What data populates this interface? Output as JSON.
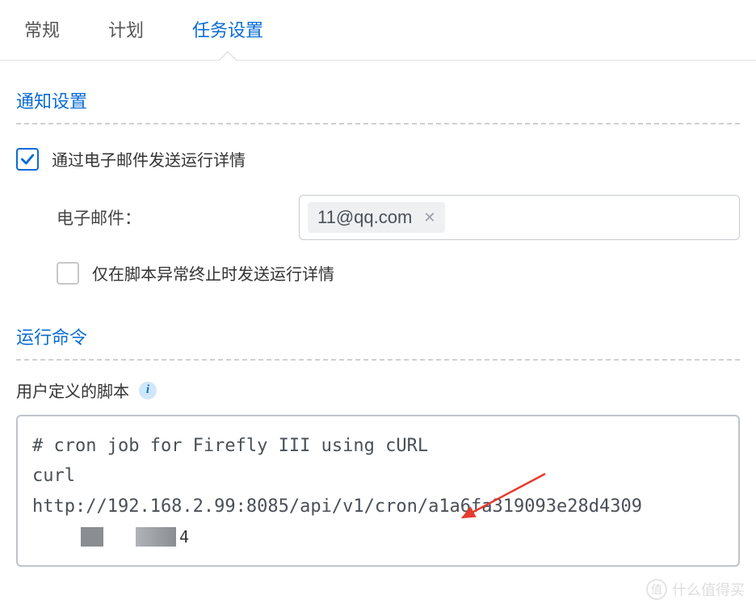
{
  "tabs": [
    {
      "label": "常规",
      "active": false
    },
    {
      "label": "计划",
      "active": false
    },
    {
      "label": "任务设置",
      "active": true
    }
  ],
  "sections": {
    "notification": {
      "title": "通知设置",
      "emailDetailsCheckbox": {
        "checked": true,
        "label": "通过电子邮件发送运行详情"
      },
      "emailField": {
        "label": "电子邮件：",
        "tag": "11@qq.com"
      },
      "onlyOnErrorCheckbox": {
        "checked": false,
        "label": "仅在脚本异常终止时发送运行详情"
      }
    },
    "runCommand": {
      "title": "运行命令",
      "userScriptLabel": "用户定义的脚本",
      "script": {
        "line1": "# cron job for Firefly III using cURL",
        "line2": "curl",
        "line3": "http://192.168.2.99:8085/api/v1/cron/a1a6fa319093e28d4309"
      }
    }
  },
  "watermark": {
    "char": "值",
    "text": "什么值得买"
  }
}
